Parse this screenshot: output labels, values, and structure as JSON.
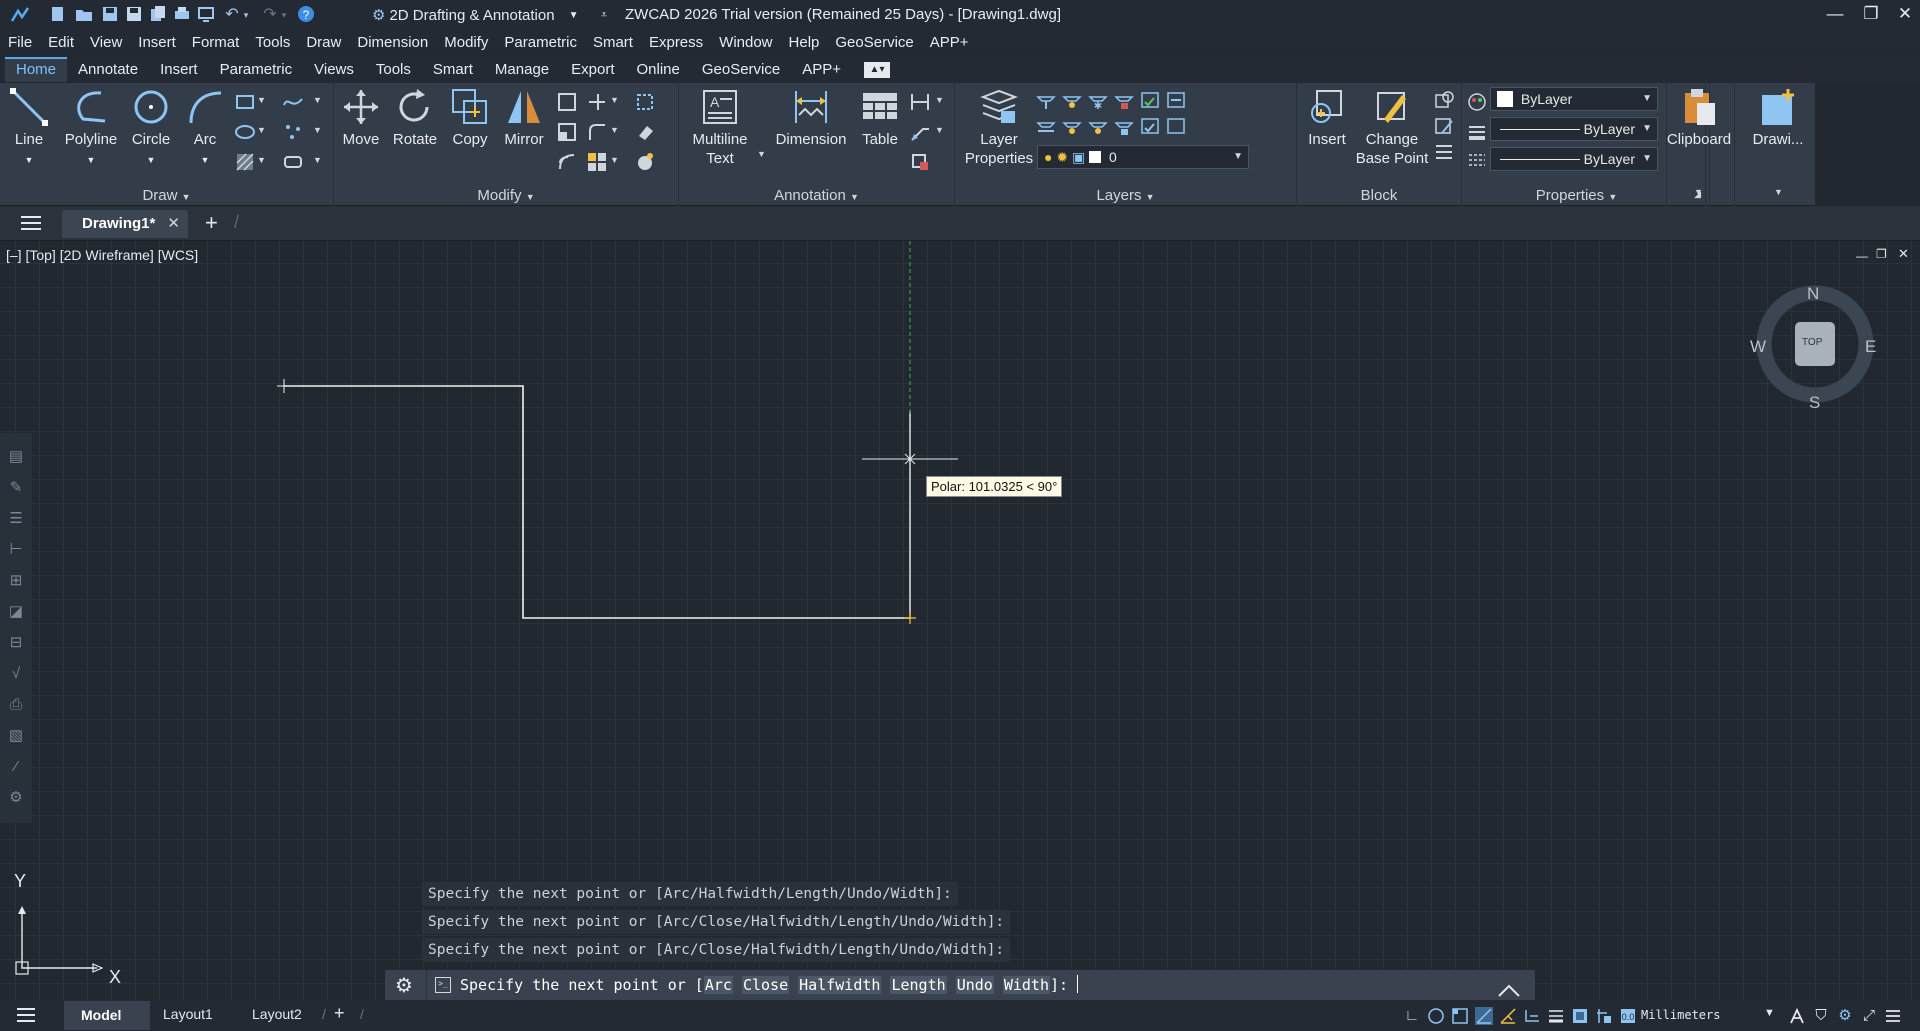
{
  "titlebar": {
    "workspace": "2D Drafting & Annotation",
    "title": "ZWCAD 2026 Trial version (Remained 25 Days) - [Drawing1.dwg]"
  },
  "menubar": [
    "File",
    "Edit",
    "View",
    "Insert",
    "Format",
    "Tools",
    "Draw",
    "Dimension",
    "Modify",
    "Parametric",
    "Smart",
    "Express",
    "Window",
    "Help",
    "GeoService",
    "APP+"
  ],
  "ribbon_tabs": [
    "Home",
    "Annotate",
    "Insert",
    "Parametric",
    "Views",
    "Tools",
    "Smart",
    "Manage",
    "Export",
    "Online",
    "GeoService",
    "APP+"
  ],
  "ribbon": {
    "draw": {
      "title": "Draw",
      "line": "Line",
      "polyline": "Polyline",
      "circle": "Circle",
      "arc": "Arc"
    },
    "modify": {
      "title": "Modify",
      "move": "Move",
      "rotate": "Rotate",
      "copy": "Copy",
      "mirror": "Mirror"
    },
    "annotation": {
      "title": "Annotation",
      "mtext_1": "Multiline",
      "mtext_2": "Text",
      "dimension": "Dimension",
      "table": "Table"
    },
    "layers": {
      "title": "Layers",
      "layer_props_1": "Layer",
      "layer_props_2": "Properties",
      "current_layer": "0"
    },
    "block": {
      "title": "Block",
      "insert": "Insert",
      "cbp_1": "Change",
      "cbp_2": "Base Point"
    },
    "properties": {
      "title": "Properties",
      "color": "ByLayer",
      "linetype": "ByLayer",
      "lineweight": "ByLayer"
    },
    "clipboard": {
      "label": "Clipboard"
    },
    "drawing": {
      "label": "Drawi..."
    }
  },
  "doc_tab": {
    "name": "Drawing1*"
  },
  "viewport": {
    "label": "[–] [Top] [2D Wireframe] [WCS]",
    "viewcube": {
      "n": "N",
      "s": "S",
      "e": "E",
      "w": "W",
      "top": "TOP"
    },
    "tooltip": "Polar: 101.0325 < 90°",
    "ucs": {
      "x": "X",
      "y": "Y"
    }
  },
  "command": {
    "history": [
      "Specify the next point or [Arc/Halfwidth/Length/Undo/Width]:",
      "Specify the next point or [Arc/Close/Halfwidth/Length/Undo/Width]:",
      "Specify the next point or [Arc/Close/Halfwidth/Length/Undo/Width]:"
    ],
    "prompt": "Specify the next point or [",
    "options": [
      "Arc",
      "Close",
      "Halfwidth",
      "Length",
      "Undo",
      "Width"
    ],
    "prompt_end": "]:"
  },
  "statusbar": {
    "tabs": [
      "Model",
      "Layout1",
      "Layout2"
    ],
    "units": "Millimeters"
  },
  "colors": {
    "accent": "#5aa8ee",
    "background": "#212830",
    "ribbon": "#333d49"
  }
}
